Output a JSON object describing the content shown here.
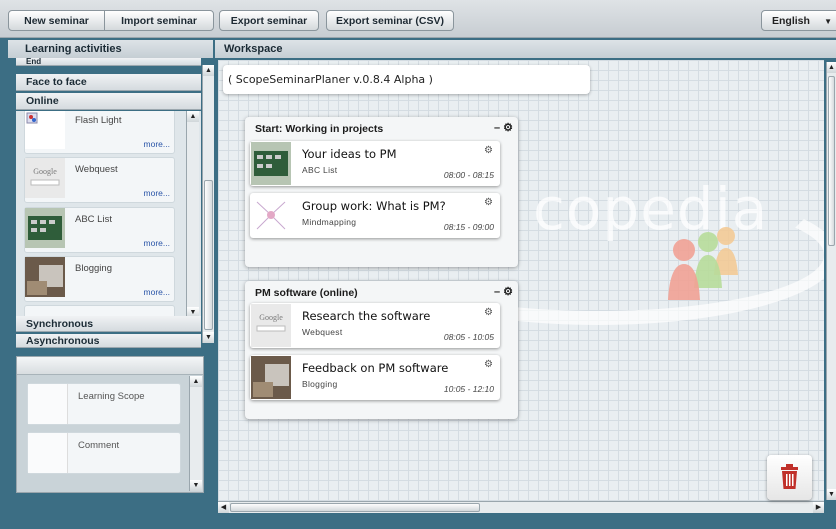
{
  "toolbar": {
    "new_seminar": "New seminar",
    "import_seminar": "Import seminar",
    "export_seminar": "Export seminar",
    "export_csv": "Export seminar (CSV)",
    "language": "English"
  },
  "left_panel": {
    "title": "Learning activities",
    "categories": {
      "end": "End",
      "face_to_face": "Face to face",
      "online": "Online",
      "synchronous": "Synchronous",
      "asynchronous": "Asynchronous"
    },
    "activities": [
      {
        "name": "Flash Light",
        "more": "more..."
      },
      {
        "name": "Webquest",
        "more": "more..."
      },
      {
        "name": "ABC List",
        "more": "more..."
      },
      {
        "name": "Blogging",
        "more": "more..."
      }
    ],
    "tools": [
      {
        "name": "Learning Scope"
      },
      {
        "name": "Comment"
      }
    ]
  },
  "workspace": {
    "title": "Workspace",
    "version": "( ScopeSeminarPlaner v.0.8.4 Alpha )",
    "watermark": "copedia",
    "groups": [
      {
        "title": "Start: Working in projects",
        "controls": "– ⚙",
        "cards": [
          {
            "title": "Your ideas to PM",
            "subtitle": "ABC List",
            "time": "08:00 - 08:15"
          },
          {
            "title": "Group work: What is PM?",
            "subtitle": "Mindmapping",
            "time": "08:15 - 09:00"
          }
        ]
      },
      {
        "title": "PM software (online)",
        "controls": "– ⚙",
        "cards": [
          {
            "title": "Research the software",
            "subtitle": "Webquest",
            "time": "08:05 - 10:05"
          },
          {
            "title": "Feedback on PM software",
            "subtitle": "Blogging",
            "time": "10:05 - 12:10"
          }
        ]
      }
    ]
  },
  "colors": {
    "background": "#3c6e84",
    "trash": "#c0302a"
  }
}
